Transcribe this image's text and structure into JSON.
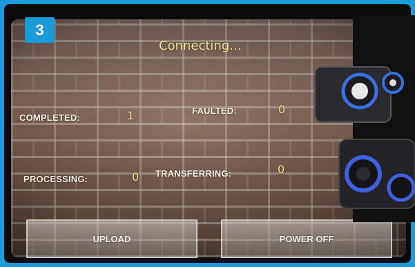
{
  "step_badge": "3",
  "status_text": "Connecting...",
  "stats": {
    "completed_label": "COMPLETED:",
    "completed_value": "1",
    "faulted_label": "FAULTED:",
    "faulted_value": "0",
    "processing_label": "PROCESSING:",
    "processing_value": "0",
    "transferring_label": "TRANSFERRING:",
    "transferring_value": "0"
  },
  "buttons": {
    "upload_label": "UPLOAD",
    "power_off_label": "POWER OFF"
  },
  "colors": {
    "badge": "#1a9ad6",
    "status_text": "#f2e79a",
    "value_text": "#f2e79a",
    "label_text": "#f4efe0"
  }
}
